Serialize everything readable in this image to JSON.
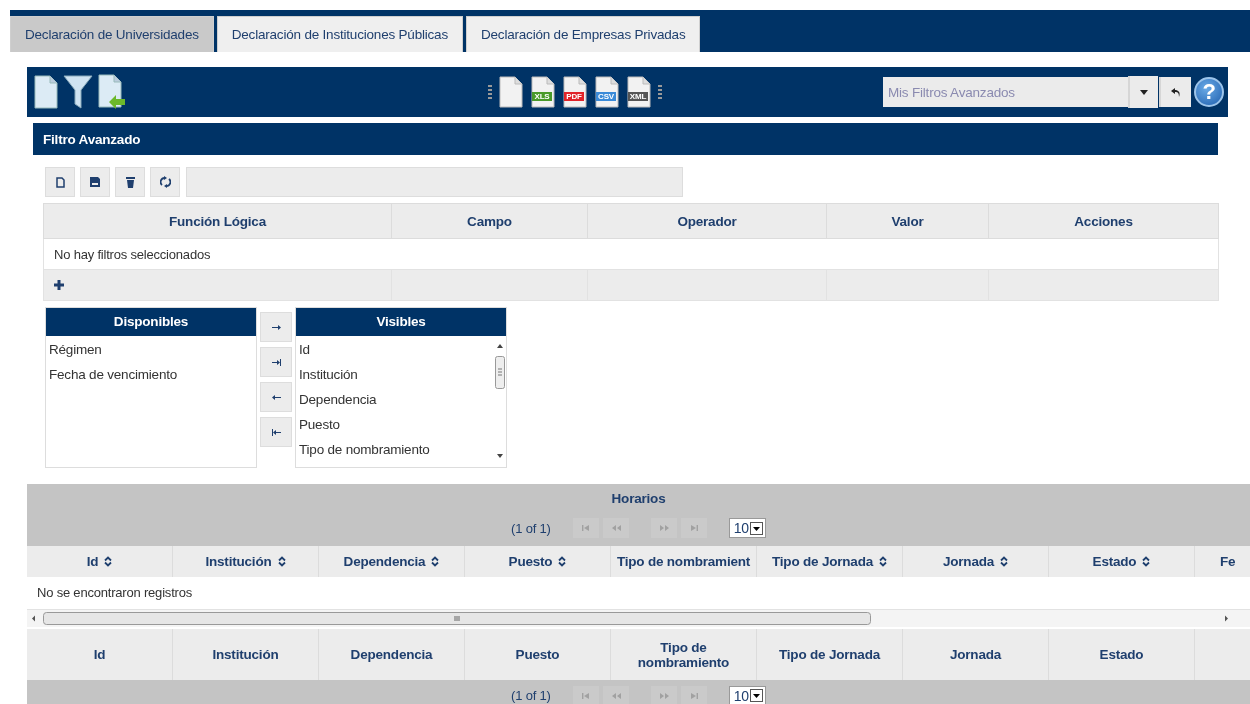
{
  "tabs": [
    {
      "label": "Declaración de Universidades",
      "selected": true
    },
    {
      "label": "Declaración de Instituciones Públicas",
      "selected": false
    },
    {
      "label": "Declaración de Empresas Privadas",
      "selected": false
    }
  ],
  "toolbar": {
    "exports": [
      {
        "kind": "blank"
      },
      {
        "kind": "xls",
        "label": "XLS"
      },
      {
        "kind": "pdf",
        "label": "PDF"
      },
      {
        "kind": "csv",
        "label": "CSV"
      },
      {
        "kind": "xml",
        "label": "XML"
      }
    ],
    "filter_select": {
      "placeholder": "Mis Filtros Avanzados"
    },
    "help": "?"
  },
  "advanced_filter": {
    "title": "Filtro Avanzado",
    "columns": [
      "Función Lógica",
      "Campo",
      "Operador",
      "Valor",
      "Acciones"
    ],
    "empty_message": "No hay filtros seleccionados"
  },
  "picklist": {
    "available": {
      "title": "Disponibles",
      "items": [
        "Régimen",
        "Fecha de vencimiento"
      ]
    },
    "visible": {
      "title": "Visibles",
      "items": [
        "Id",
        "Institución",
        "Dependencia",
        "Puesto",
        "Tipo de nombramiento"
      ]
    }
  },
  "grid": {
    "title": "Horarios",
    "paginator": {
      "page_report": "(1 of 1)",
      "rows_per_page": "10"
    },
    "columns": [
      {
        "label": "Id",
        "sortable": true
      },
      {
        "label": "Institución",
        "sortable": true
      },
      {
        "label": "Dependencia",
        "sortable": true
      },
      {
        "label": "Puesto",
        "sortable": true
      },
      {
        "label": "Tipo de nombramient",
        "sortable": false
      },
      {
        "label": "Tipo de Jornada",
        "sortable": true
      },
      {
        "label": "Jornada",
        "sortable": true
      },
      {
        "label": "Estado",
        "sortable": true
      },
      {
        "label": "Fe",
        "sortable": false
      }
    ],
    "empty_message": "No se encontraron registros",
    "footer_columns": [
      "Id",
      "Institución",
      "Dependencia",
      "Puesto",
      "Tipo de nombramiento",
      "Tipo de Jornada",
      "Jornada",
      "Estado"
    ],
    "footer_paginator": {
      "page_report": "(1 of 1)",
      "rows_per_page": "10"
    }
  }
}
